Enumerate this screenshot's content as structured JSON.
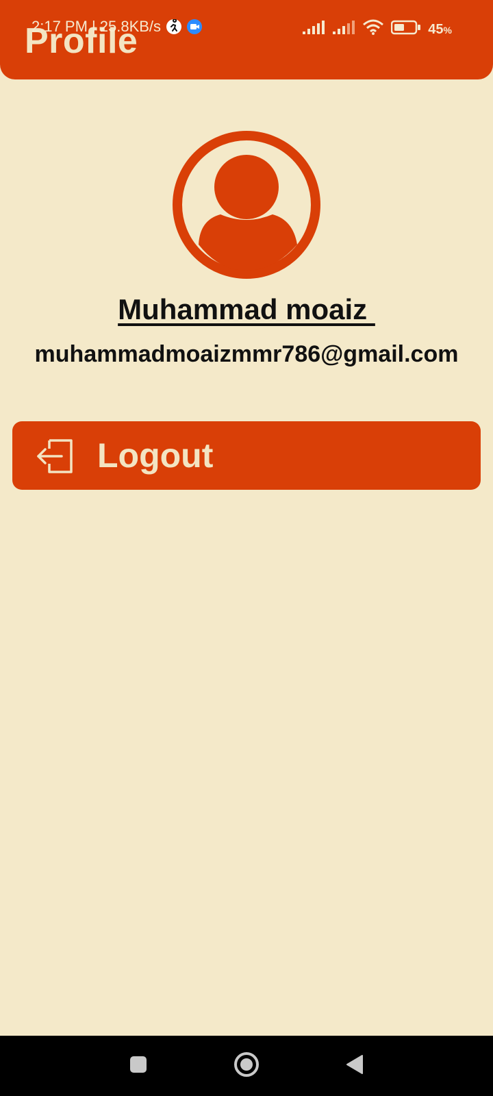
{
  "status_bar": {
    "time": "2:17 PM",
    "speed": "| 25.8KB/s",
    "battery": "45",
    "battery_unit": "%"
  },
  "app_bar": {
    "title": "Profile"
  },
  "profile": {
    "name": "Muhammad moaiz ",
    "email": "muhammadmoaizmmr786@gmail.com"
  },
  "actions": {
    "logout_label": "Logout"
  },
  "colors": {
    "accent": "#d93f07",
    "background": "#f4e9c9",
    "on_accent_text": "#f3e4c2"
  }
}
